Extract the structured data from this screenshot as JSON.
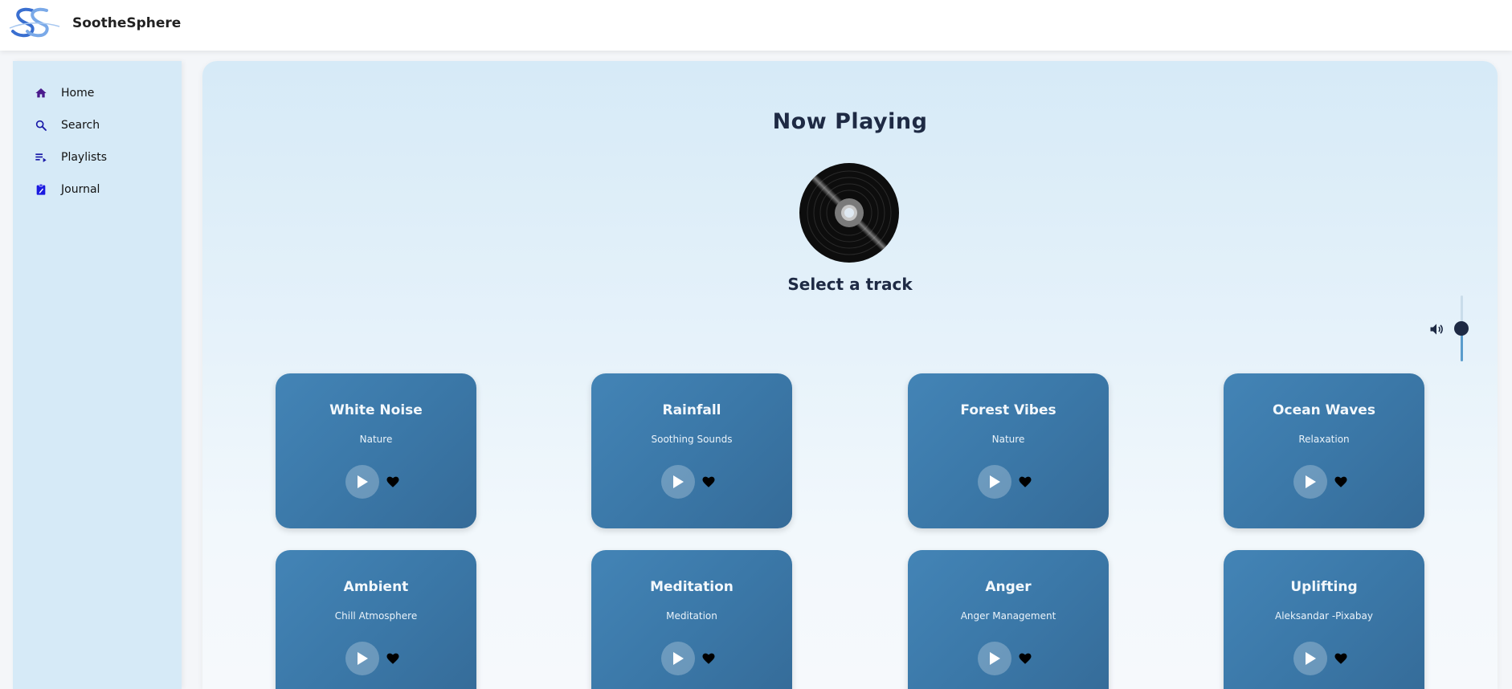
{
  "app": {
    "name": "SootheSphere",
    "logo_icon": "ss-monogram-logo"
  },
  "sidebar": {
    "items": [
      {
        "label": "Home",
        "icon": "home-icon",
        "color": "#4a1a8c"
      },
      {
        "label": "Search",
        "icon": "search-icon",
        "color": "#1a1aa8"
      },
      {
        "label": "Playlists",
        "icon": "playlist-icon",
        "color": "#1a1aa8"
      },
      {
        "label": "Journal",
        "icon": "clipboard-icon",
        "color": "#1a1ae0"
      }
    ]
  },
  "player": {
    "heading": "Now Playing",
    "track_title": "Select a track",
    "volume_icon": "volume-icon",
    "volume_level": 0.5
  },
  "tracks": [
    {
      "title": "White Noise",
      "subtitle": "Nature"
    },
    {
      "title": "Rainfall",
      "subtitle": "Soothing Sounds"
    },
    {
      "title": "Forest Vibes",
      "subtitle": "Nature"
    },
    {
      "title": "Ocean Waves",
      "subtitle": "Relaxation"
    },
    {
      "title": "Ambient",
      "subtitle": "Chill Atmosphere"
    },
    {
      "title": "Meditation",
      "subtitle": "Meditation"
    },
    {
      "title": "Anger",
      "subtitle": "Anger Management"
    },
    {
      "title": "Uplifting",
      "subtitle": "Aleksandar -Pixabay"
    }
  ],
  "colors": {
    "card": "#3b78a8",
    "panel": "#d6eaf7",
    "text_dark": "#1e2a44"
  }
}
